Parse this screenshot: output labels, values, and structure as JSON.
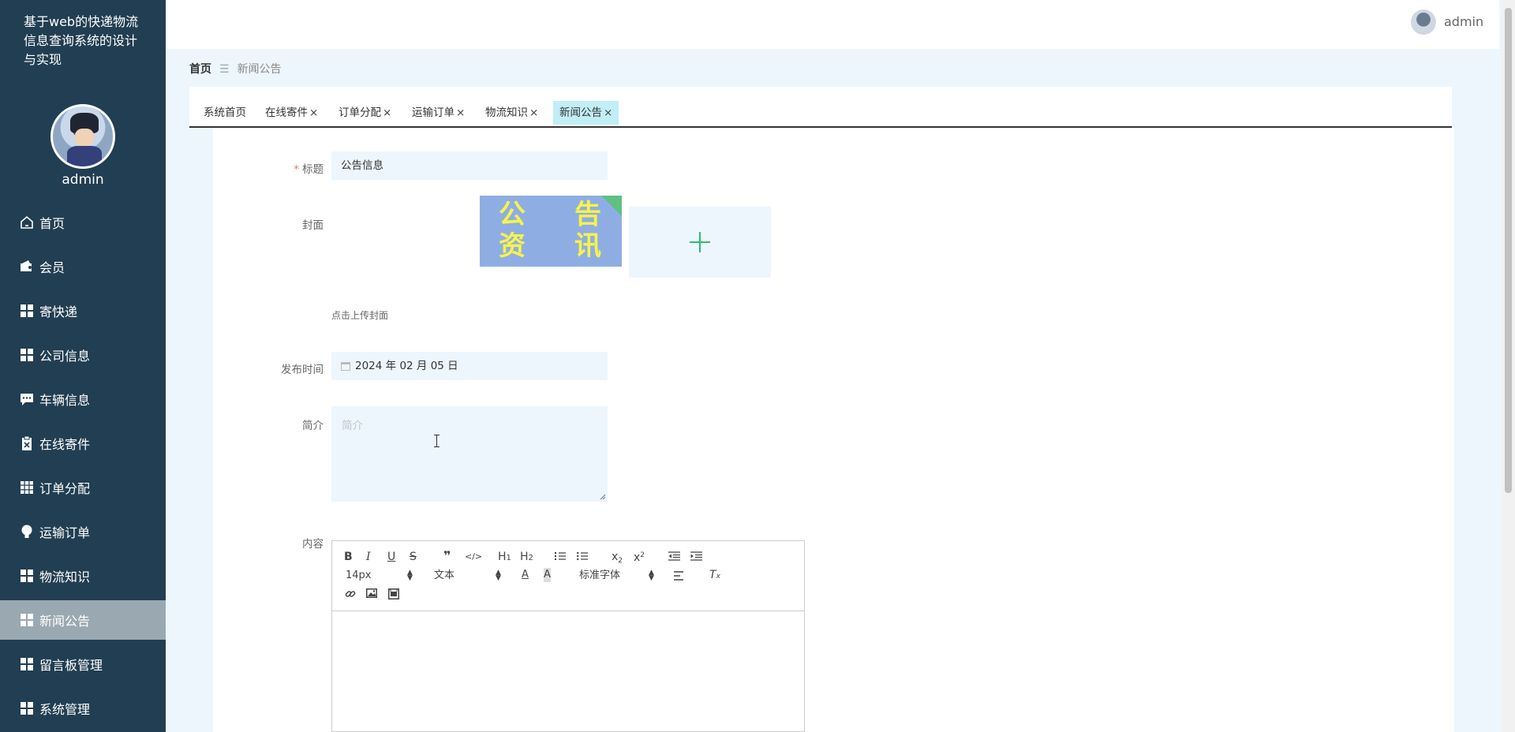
{
  "sidebar": {
    "system_title": "基于web的快递物流信息查询系统的设计与实现",
    "user_name": "admin",
    "items": [
      {
        "label": "首页",
        "icon": "home-icon"
      },
      {
        "label": "会员",
        "icon": "wallet-icon"
      },
      {
        "label": "寄快递",
        "icon": "grid-icon"
      },
      {
        "label": "公司信息",
        "icon": "grid-icon"
      },
      {
        "label": "车辆信息",
        "icon": "chat-icon"
      },
      {
        "label": "在线寄件",
        "icon": "clipboard-icon"
      },
      {
        "label": "订单分配",
        "icon": "apps-icon"
      },
      {
        "label": "运输订单",
        "icon": "bulb-icon"
      },
      {
        "label": "物流知识",
        "icon": "grid-icon"
      },
      {
        "label": "新闻公告",
        "icon": "grid-icon",
        "active": true
      },
      {
        "label": "留言板管理",
        "icon": "grid-icon"
      },
      {
        "label": "系统管理",
        "icon": "grid-icon"
      }
    ]
  },
  "header": {
    "user_name": "admin"
  },
  "breadcrumb": {
    "home": "首页",
    "separator": "☰",
    "current": "新闻公告"
  },
  "tabs": [
    {
      "label": "系统首页",
      "closable": false
    },
    {
      "label": "在线寄件",
      "closable": true
    },
    {
      "label": "订单分配",
      "closable": true
    },
    {
      "label": "运输订单",
      "closable": true
    },
    {
      "label": "物流知识",
      "closable": true
    },
    {
      "label": "新闻公告",
      "closable": true,
      "active": true
    }
  ],
  "form": {
    "title_label": "标题",
    "title_value": "公告信息",
    "cover_label": "封面",
    "cover_image_text": [
      "公",
      "告",
      "资",
      "讯"
    ],
    "upload_hint": "点击上传封面",
    "publish_time_label": "发布时间",
    "publish_time_value": "2024 年 02 月 05 日",
    "intro_label": "简介",
    "intro_placeholder": "简介",
    "content_label": "内容"
  },
  "editor": {
    "font_size": "14px",
    "header_select": "文本",
    "font_family": "标准字体"
  },
  "colors": {
    "sidebar_bg": "#223e52",
    "active_menu_bg": "#9aa9b1",
    "active_tab_bg": "#c2eef6",
    "input_bg": "#edf6fd",
    "upload_plus": "#2fba75"
  }
}
